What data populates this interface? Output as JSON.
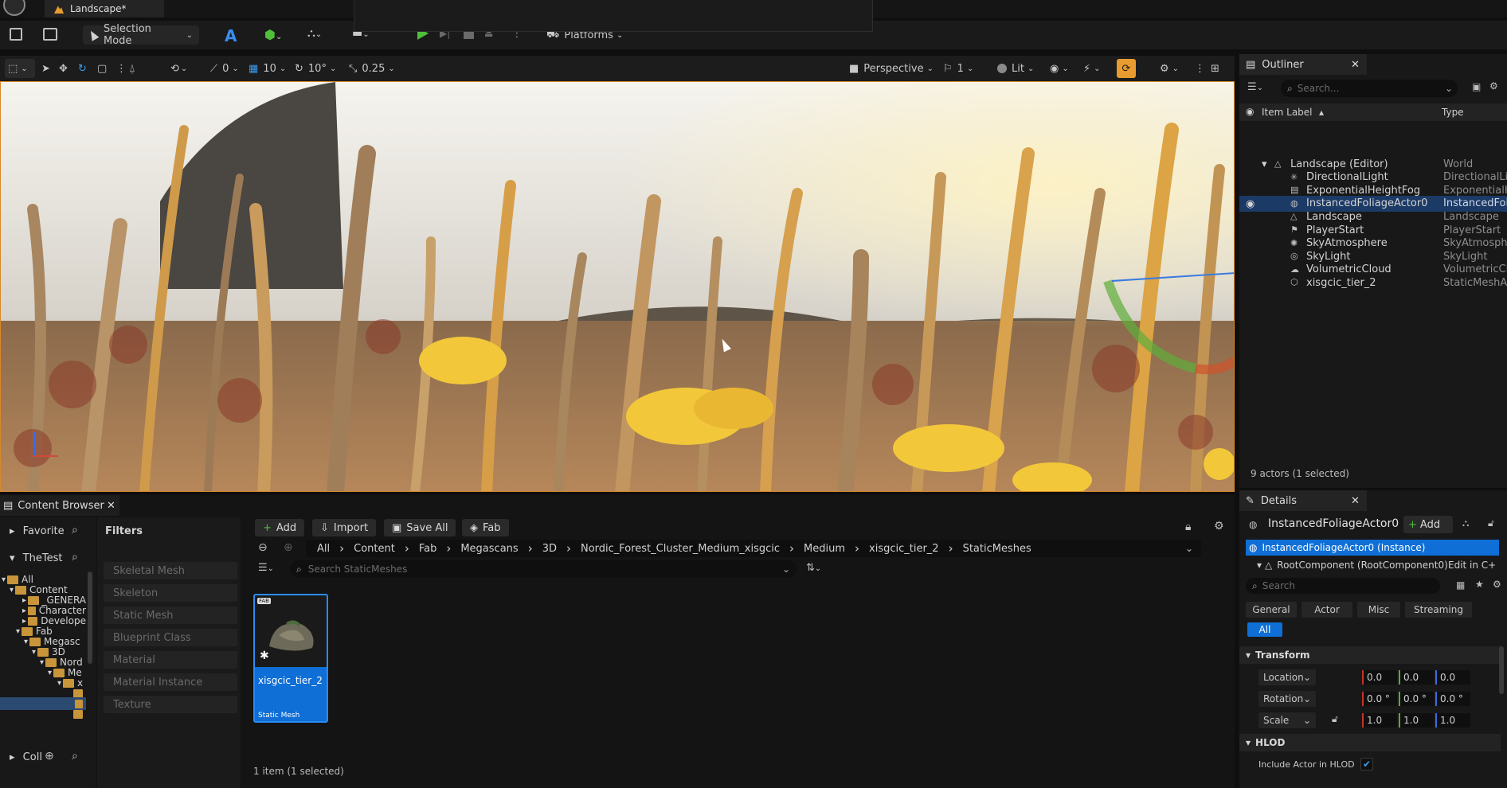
{
  "title_bar": {
    "level_tab": "Landscape*"
  },
  "toolbar": {
    "selection_mode": "Selection Mode",
    "platforms": "Platforms"
  },
  "viewport_toolbar": {
    "angle_snap_val": "0",
    "grid_snap_val": "10",
    "rot_snap_val": "10°",
    "scale_snap_val": "0.25",
    "perspective": "Perspective",
    "camera_speed": "1",
    "lit": "Lit"
  },
  "outliner": {
    "tab": "Outliner",
    "search_placeholder": "Search...",
    "col_label": "Item Label",
    "col_type": "Type",
    "items": [
      {
        "label": "Landscape (Editor)",
        "type": "World"
      },
      {
        "label": "DirectionalLight",
        "type": "DirectionalLig"
      },
      {
        "label": "ExponentialHeightFog",
        "type": "ExponentialHe"
      },
      {
        "label": "InstancedFoliageActor0",
        "type": "InstancedFoli"
      },
      {
        "label": "Landscape",
        "type": "Landscape"
      },
      {
        "label": "PlayerStart",
        "type": "PlayerStart"
      },
      {
        "label": "SkyAtmosphere",
        "type": "SkyAtmosphe"
      },
      {
        "label": "SkyLight",
        "type": "SkyLight"
      },
      {
        "label": "VolumetricCloud",
        "type": "VolumetricClo"
      },
      {
        "label": "xisgcic_tier_2",
        "type": "StaticMeshAc"
      }
    ],
    "status": "9 actors (1 selected)"
  },
  "details": {
    "tab": "Details",
    "actor_name": "InstancedFoliageActor0",
    "add_label": "Add",
    "instance_label": "InstancedFoliageActor0 (Instance)",
    "root_component": "RootComponent (RootComponent0)",
    "edit_in": "Edit in C+",
    "search_placeholder": "Search",
    "filter_tabs": [
      "General",
      "Actor",
      "Misc",
      "Streaming"
    ],
    "filter_all": "All",
    "transform_header": "Transform",
    "location_label": "Location",
    "rotation_label": "Rotation",
    "scale_label": "Scale",
    "location": [
      "0.0",
      "0.0",
      "0.0"
    ],
    "rotation": [
      "0.0 °",
      "0.0 °",
      "0.0 °"
    ],
    "scale": [
      "1.0",
      "1.0",
      "1.0"
    ],
    "hlod_header": "HLOD",
    "include_hlod": "Include Actor in HLOD",
    "include_hlod_checked": true
  },
  "content_browser": {
    "tab": "Content Browser",
    "favorite": "Favorite",
    "project": "TheTest",
    "collections": "Coll",
    "filters_header": "Filters",
    "filters": [
      "Skeletal Mesh",
      "Skeleton",
      "Static Mesh",
      "Blueprint Class",
      "Material",
      "Material Instance",
      "Texture"
    ],
    "buttons": {
      "add": "Add",
      "import": "Import",
      "save_all": "Save All",
      "fab": "Fab"
    },
    "breadcrumb": [
      "All",
      "Content",
      "Fab",
      "Megascans",
      "3D",
      "Nordic_Forest_Cluster_Medium_xisgcic",
      "Medium",
      "xisgcic_tier_2",
      "StaticMeshes"
    ],
    "search_placeholder": "Search StaticMeshes",
    "tree": [
      "All",
      "Content",
      "_GENERA",
      "Character",
      "Develope",
      "Fab",
      "Megasc",
      "3D",
      "Nord",
      "Me",
      "x"
    ],
    "asset": {
      "name": "xisgcic_tier_2",
      "type": "Static Mesh",
      "badge": "FAB"
    },
    "status": "1 item (1 selected)"
  },
  "colors": {
    "accent_orange": "#e89b2e",
    "selection_blue": "#0f6fd6",
    "play_green": "#4fbf3a"
  }
}
